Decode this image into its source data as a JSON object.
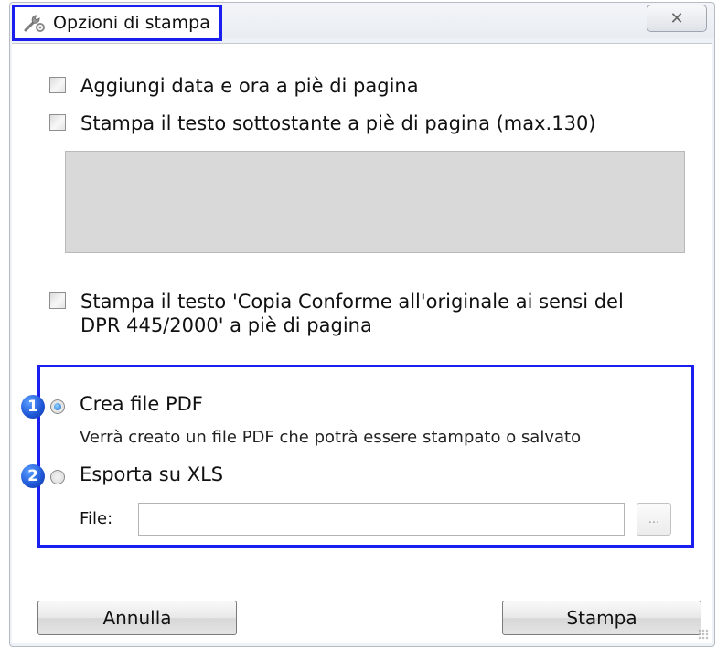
{
  "window": {
    "title": "Opzioni di stampa",
    "close_glyph": "✕"
  },
  "checkboxes": [
    {
      "label": "Aggiungi data e ora a piè di pagina",
      "checked": false
    },
    {
      "label": "Stampa il testo sottostante a piè di pagina (max.130)",
      "checked": false
    },
    {
      "label_line1": "Stampa il testo 'Copia Conforme all'originale ai sensi del",
      "label_line2": "DPR 445/2000' a piè di pagina",
      "checked": false
    }
  ],
  "footer_text": {
    "value": ""
  },
  "output": {
    "badges": [
      "1",
      "2"
    ],
    "pdf_option": {
      "label": "Crea file PDF",
      "selected": true,
      "description": "Verrà creato un file PDF che potrà essere stampato o salvato"
    },
    "xls_option": {
      "label": "Esporta su XLS",
      "selected": false
    },
    "file_label": "File:",
    "file_value": "",
    "browse_label": "..."
  },
  "buttons": {
    "cancel": "Annulla",
    "print": "Stampa"
  },
  "colors": {
    "highlight_border": "#1a1ff0",
    "badge": "#1f55d6"
  }
}
